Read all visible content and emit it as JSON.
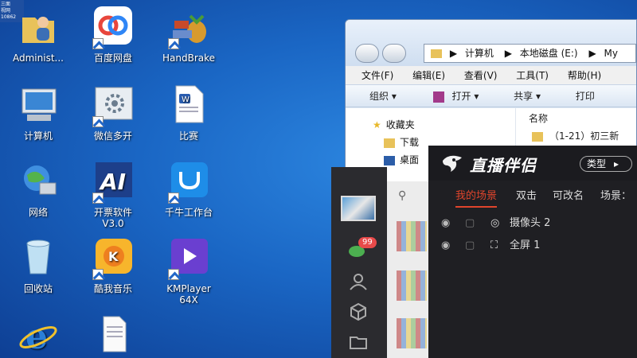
{
  "corner_badge": [
    "三面",
    "视网",
    "10862"
  ],
  "desktop_icons": [
    {
      "label": "Administ...",
      "icon": "user-folder-icon"
    },
    {
      "label": "百度网盘",
      "icon": "baidu-netdisk-icon"
    },
    {
      "label": "HandBrake",
      "icon": "handbrake-icon"
    },
    {
      "label": "计算机",
      "icon": "computer-icon"
    },
    {
      "label": "微信多开",
      "icon": "wechat-multi-icon"
    },
    {
      "label": "比赛",
      "icon": "word-document-icon"
    },
    {
      "label": "网络",
      "icon": "network-icon"
    },
    {
      "label": "开票软件\nV3.0",
      "icon": "invoice-software-icon"
    },
    {
      "label": "千牛工作台",
      "icon": "qianniu-icon"
    },
    {
      "label": "回收站",
      "icon": "recycle-bin-icon"
    },
    {
      "label": "酷我音乐",
      "icon": "kuwo-music-icon"
    },
    {
      "label": "KMPlayer\n64X",
      "icon": "kmplayer-icon"
    },
    {
      "label": "",
      "icon": "internet-explorer-icon"
    },
    {
      "label": "",
      "icon": "text-document-icon"
    }
  ],
  "explorer": {
    "address_parts": [
      "计算机",
      "本地磁盘 (E:)",
      "My"
    ],
    "menu": [
      "文件(F)",
      "编辑(E)",
      "查看(V)",
      "工具(T)",
      "帮助(H)"
    ],
    "toolbar": [
      "组织 ▾",
      "打开 ▾",
      "共享 ▾",
      "打印"
    ],
    "nav_items": [
      "收藏夹",
      "下载",
      "桌面"
    ],
    "column_header": "名称",
    "file_row": "（1-21）初三新"
  },
  "side_panel": {
    "badge_count": "99"
  },
  "live_panel": {
    "title": "直播伴侣",
    "type_button": "类型",
    "tabs": [
      "我的场景",
      "双击",
      "可改名",
      "场景："
    ],
    "scenes": [
      "摄像头 2",
      "全屏 1"
    ]
  }
}
